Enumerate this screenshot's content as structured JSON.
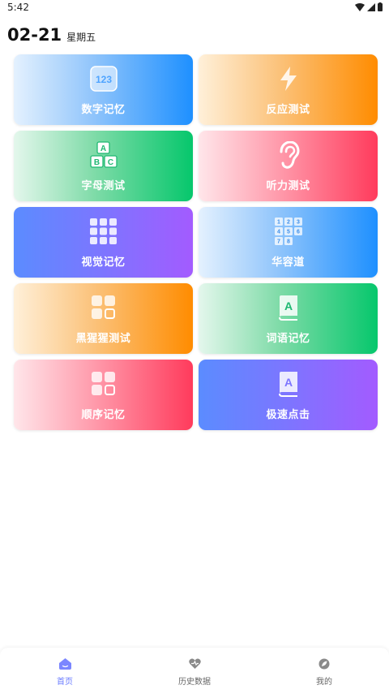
{
  "status": {
    "time": "5:42"
  },
  "header": {
    "date": "02-21",
    "weekday": "星期五"
  },
  "cards": [
    {
      "label": "数字记忆",
      "icon": "number-123-icon"
    },
    {
      "label": "反应测试",
      "icon": "lightning-icon"
    },
    {
      "label": "字母测试",
      "icon": "abc-blocks-icon"
    },
    {
      "label": "听力测试",
      "icon": "ear-icon"
    },
    {
      "label": "视觉记忆",
      "icon": "grid-dots-icon"
    },
    {
      "label": "华容道",
      "icon": "number-grid-icon",
      "icon_digits": [
        "1",
        "2",
        "3",
        "4",
        "5",
        "6",
        "7",
        "8"
      ]
    },
    {
      "label": "黑猩猩测试",
      "icon": "squares-icon"
    },
    {
      "label": "词语记忆",
      "icon": "book-icon"
    },
    {
      "label": "顺序记忆",
      "icon": "squares-icon"
    },
    {
      "label": "极速点击",
      "icon": "book-icon"
    }
  ],
  "icon_text": {
    "numbers": "123",
    "letter_a": "A",
    "letter_b": "B",
    "letter_c": "C",
    "book_letter": "A"
  },
  "nav": [
    {
      "label": "首页",
      "icon": "home-icon",
      "active": true
    },
    {
      "label": "历史数据",
      "icon": "heart-chart-icon",
      "active": false
    },
    {
      "label": "我的",
      "icon": "leaf-icon",
      "active": false
    }
  ],
  "colors": {
    "accent": "#6b7cff",
    "blue": "#1e90ff",
    "orange": "#ff8c00",
    "green": "#06c76c",
    "red": "#ff3b5c",
    "purple": "#a35bff"
  }
}
